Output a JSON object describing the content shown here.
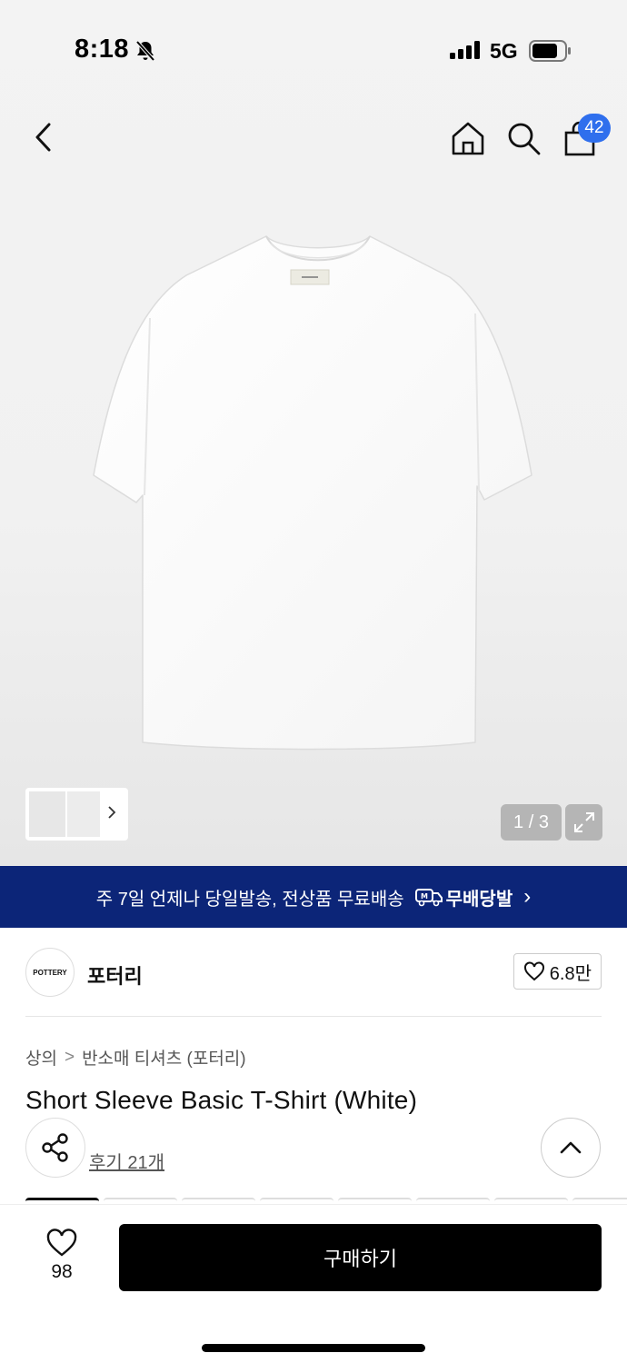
{
  "status_bar": {
    "time": "8:18",
    "network": "5G",
    "icons": [
      "bell-slash-icon",
      "signal-icon",
      "battery-icon"
    ]
  },
  "nav": {
    "back_icon": "chevron-left-icon",
    "home_icon": "home-icon",
    "search_icon": "search-icon",
    "cart_icon": "shopping-bag-icon",
    "cart_count": "42"
  },
  "gallery": {
    "page_counter": "1 / 3",
    "current_page": 1,
    "total_pages": 3,
    "expand_icon": "expand-icon"
  },
  "banner": {
    "text": "주 7일 언제나 당일발송, 전상품 무료배송",
    "badge_label": "무배당발",
    "chevron": "›"
  },
  "brand": {
    "logo_text": "POTTERY",
    "name": "포터리",
    "like_count": "6.8만"
  },
  "breadcrumb": {
    "category": "상의",
    "separator": ">",
    "subcategory": "반소매 티셔츠 (포터리)"
  },
  "product": {
    "title": "Short Sleeve Basic T-Shirt (White)",
    "review_link": "후기 21개"
  },
  "bottom_bar": {
    "like_count": "98",
    "buy_label": "구매하기"
  },
  "colors": {
    "banner_bg": "#0c2578",
    "badge_blue": "#2f6fed",
    "buy_button": "#000000"
  }
}
